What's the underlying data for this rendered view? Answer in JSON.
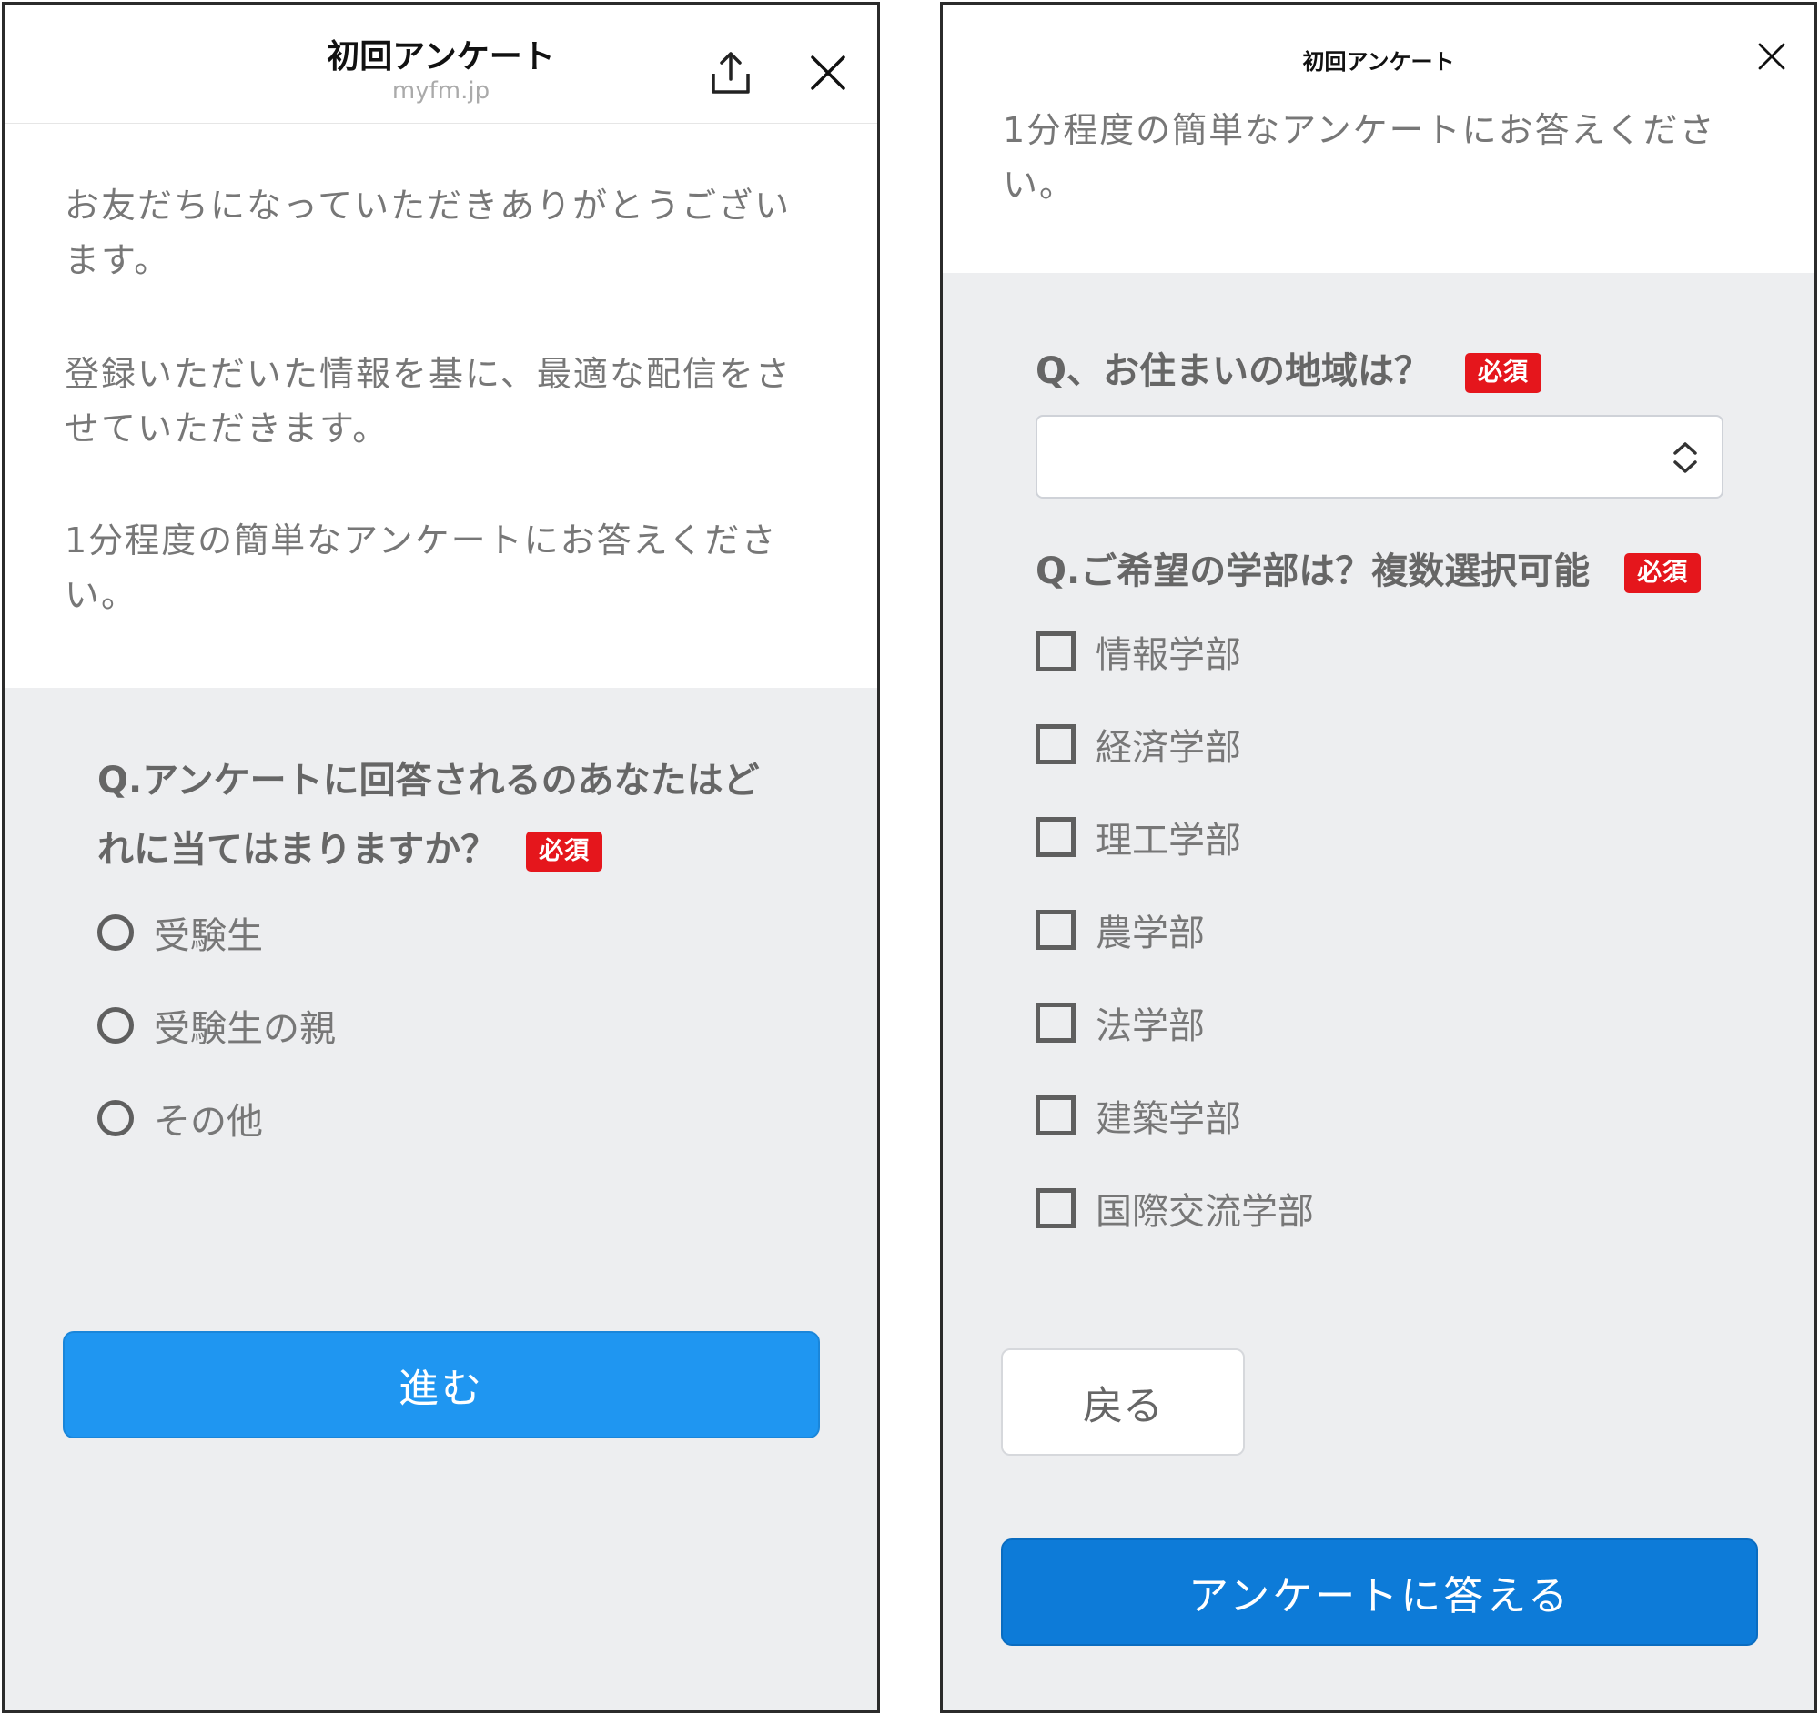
{
  "left": {
    "header": {
      "title": "初回アンケート",
      "domain": "myfm.jp"
    },
    "intro": {
      "p1_line1": "お友だちになっていただきありがとうござい",
      "p1_line2": "ます。",
      "p2_line1": "登録いただいた情報を基に、最適な配信をさ",
      "p2_line2": "せていただきます。",
      "p3_line1": "1分程度の簡単なアンケートにお答えくださ",
      "p3_line2": "い。"
    },
    "question": {
      "line1": "Q.アンケートに回答されるのあなたはど",
      "line2": "れに当てはまりますか？",
      "required": "必須",
      "options": [
        "受験生",
        "受験生の親",
        "その他"
      ]
    },
    "next_label": "進む"
  },
  "right": {
    "header": {
      "title": "初回アンケート"
    },
    "intro": {
      "line1": "1分程度の簡単なアンケートにお答えくださ",
      "line2": "い。"
    },
    "q1": {
      "title": "Q、お住まいの地域は？",
      "required": "必須",
      "selected_value": ""
    },
    "q2": {
      "title": "Q.ご希望の学部は？複数選択可能",
      "required": "必須",
      "options": [
        "情報学部",
        "経済学部",
        "理工学部",
        "農学部",
        "法学部",
        "建築学部",
        "国際交流学部"
      ]
    },
    "back_label": "戻る",
    "submit_label": "アンケートに答える"
  },
  "colors": {
    "primary": "#1f96f1",
    "submit": "#0d7bd8",
    "required_badge": "#e5161c",
    "form_background": "#edeef0"
  }
}
